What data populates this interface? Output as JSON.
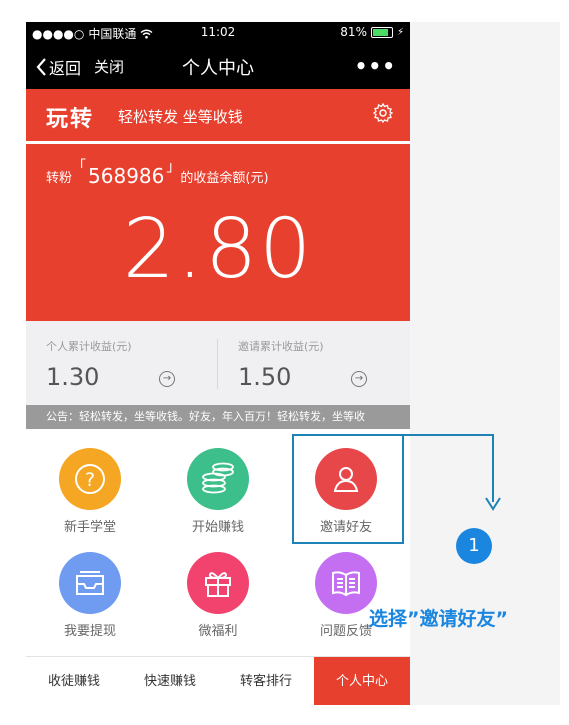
{
  "status_bar": {
    "carrier": "中国联通",
    "time": "11:02",
    "battery": "81%",
    "battery_level": 0.81
  },
  "nav": {
    "back": "返回",
    "close": "关闭",
    "title": "个人中心"
  },
  "brand": {
    "logo": "玩转",
    "slogan": "轻松转发 坐等收钱"
  },
  "balance": {
    "prefix": "转粉",
    "user_id": "568986",
    "suffix": "的收益余额(元)",
    "amount": "2.80"
  },
  "stats": [
    {
      "label": "个人累计收益(元)",
      "value": "1.30"
    },
    {
      "label": "邀请累计收益(元)",
      "value": "1.50"
    }
  ],
  "notice": "公告：轻松转发，坐等收钱。好友，年入百万！轻松转发，坐等收",
  "grid": [
    {
      "label": "新手学堂",
      "icon": "question-icon",
      "color": "#f5a623"
    },
    {
      "label": "开始赚钱",
      "icon": "coins-icon",
      "color": "#3cbf8a"
    },
    {
      "label": "邀请好友",
      "icon": "person-icon",
      "color": "#e8474a"
    },
    {
      "label": "我要提现",
      "icon": "inbox-icon",
      "color": "#6f9bf0"
    },
    {
      "label": "微福利",
      "icon": "gift-icon",
      "color": "#f2436e"
    },
    {
      "label": "问题反馈",
      "icon": "book-icon",
      "color": "#c46ff2"
    }
  ],
  "tabs": [
    {
      "label": "收徒赚钱"
    },
    {
      "label": "快速赚钱"
    },
    {
      "label": "转客排行"
    },
    {
      "label": "个人中心"
    }
  ],
  "annotation": {
    "step": "1",
    "text": "选择”邀请好友”"
  },
  "colors": {
    "brand_red": "#e8402f",
    "annotation_blue": "#1a86e0"
  }
}
